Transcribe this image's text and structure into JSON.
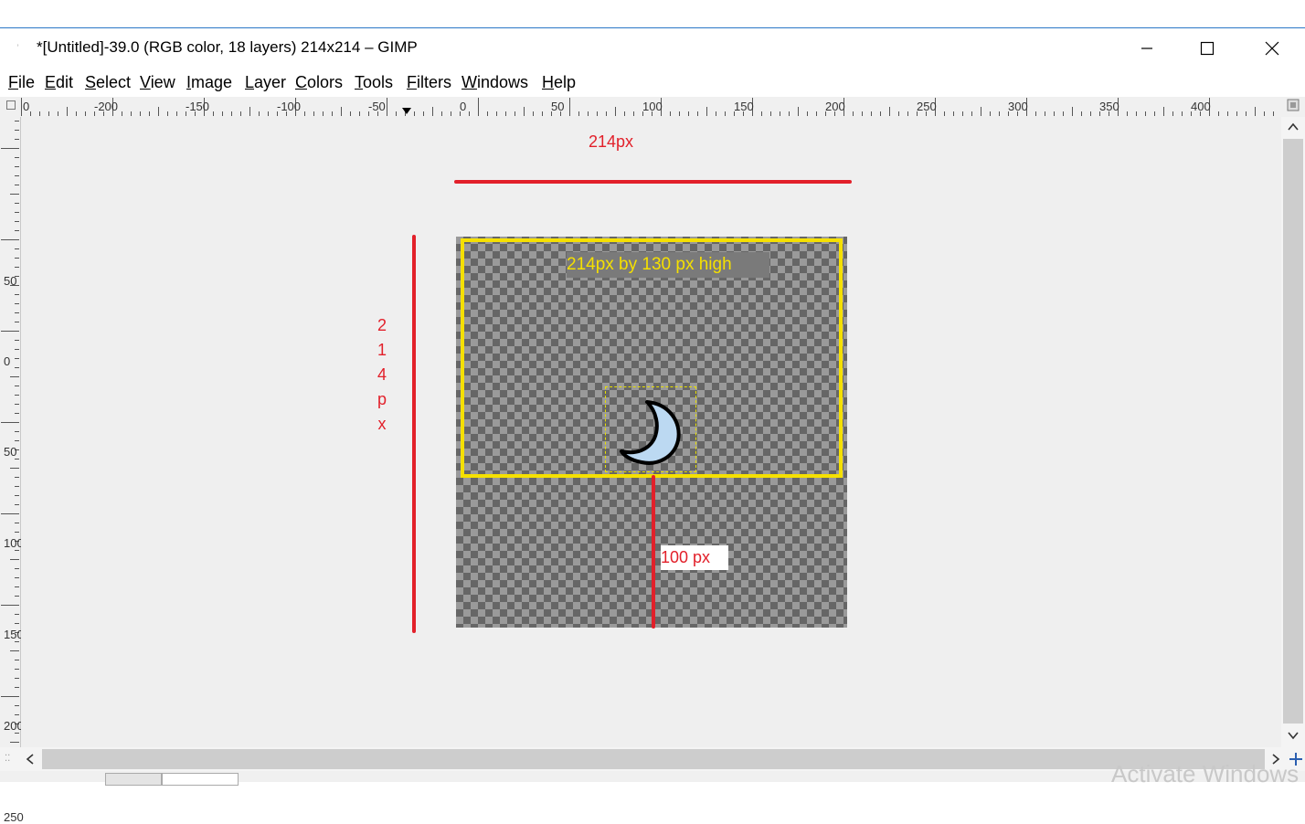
{
  "window": {
    "title": "*[Untitled]-39.0 (RGB color, 18 layers) 214x214 – GIMP",
    "controls": [
      "minimize-icon",
      "maximize-icon",
      "close-icon"
    ]
  },
  "menu": {
    "items": [
      {
        "label": "File"
      },
      {
        "label": "Edit"
      },
      {
        "label": "Select"
      },
      {
        "label": "View"
      },
      {
        "label": "Image"
      },
      {
        "label": "Layer"
      },
      {
        "label": "Colors"
      },
      {
        "label": "Tools"
      },
      {
        "label": "Filters"
      },
      {
        "label": "Windows"
      },
      {
        "label": "Help"
      }
    ]
  },
  "rulers": {
    "horizontal_labels": [
      "0",
      "-200",
      "-150",
      "-100",
      "-50",
      "0",
      "50",
      "100",
      "150",
      "200",
      "250",
      "300",
      "350",
      "400"
    ],
    "vertical_labels": [
      "50",
      "0",
      "50",
      "100",
      "150",
      "200",
      "250"
    ]
  },
  "annotations": {
    "width_label": "214px",
    "height_chars": [
      "2",
      "1",
      "4",
      "p",
      "x"
    ],
    "box_label": "214px by 130 px high",
    "offset_label": "100 px"
  },
  "colors": {
    "annotation_red": "#e2202a",
    "highlight_yellow": "#f5e000",
    "moon_fill": "#bcd9f2"
  },
  "watermark": "Activate Windows"
}
